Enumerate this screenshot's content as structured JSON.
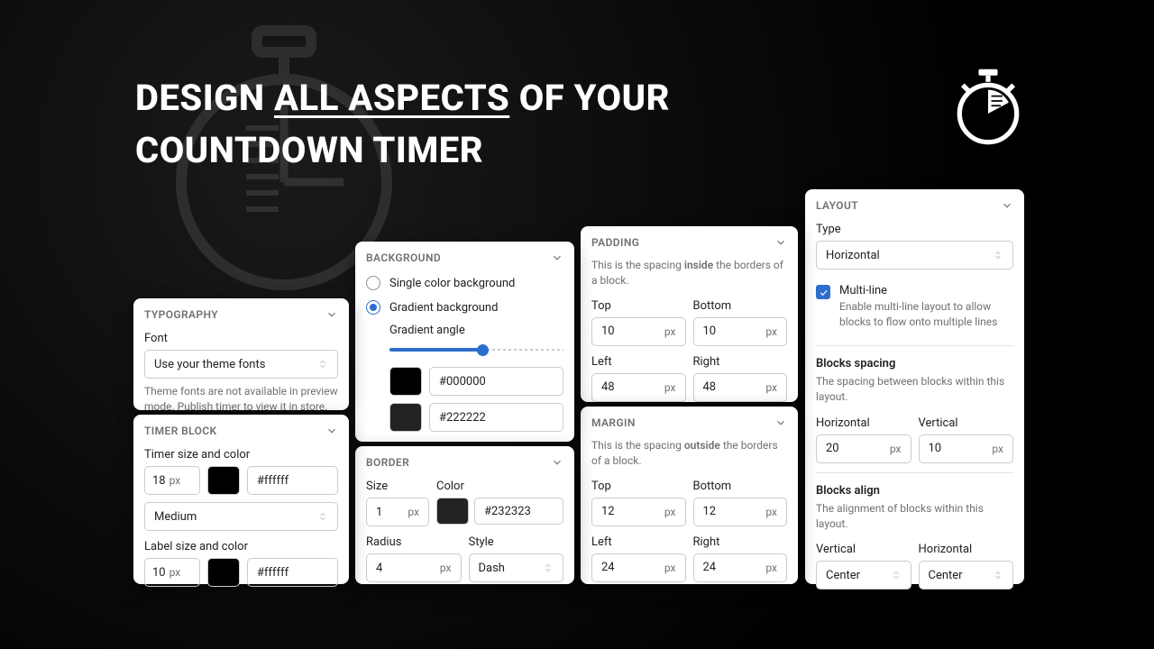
{
  "hero": {
    "line1_a": "DESIGN ",
    "line1_b": "ALL ASPECTS",
    "line1_c": " OF YOUR",
    "line2": "COUNTDOWN TIMER"
  },
  "layout": {
    "title": "LAYOUT",
    "type_label": "Type",
    "type_value": "Horizontal",
    "multiline_label": "Multi-line",
    "multiline_help": "Enable multi-line layout to allow blocks to flow onto multiple lines",
    "spacing_title": "Blocks spacing",
    "spacing_help": "The spacing between blocks within this layout.",
    "h_label": "Horizontal",
    "h_value": "20",
    "v_label": "Vertical",
    "v_value": "10",
    "unit": "px",
    "align_title": "Blocks align",
    "align_help": "The alignment of blocks within this layout.",
    "va_label": "Vertical",
    "va_value": "Center",
    "ha_label": "Horizontal",
    "ha_value": "Center"
  },
  "padding": {
    "title": "PADDING",
    "help_a": "This is the spacing ",
    "help_b": "inside",
    "help_c": " the borders of a block.",
    "top": "Top",
    "bottom": "Bottom",
    "left": "Left",
    "right": "Right",
    "unit": "px",
    "top_v": "10",
    "bottom_v": "10",
    "left_v": "48",
    "right_v": "48"
  },
  "margin": {
    "title": "MARGIN",
    "help_a": "This is the spacing ",
    "help_b": "outside",
    "help_c": " the borders of a block.",
    "top": "Top",
    "bottom": "Bottom",
    "left": "Left",
    "right": "Right",
    "unit": "px",
    "top_v": "12",
    "bottom_v": "12",
    "left_v": "24",
    "right_v": "24"
  },
  "background": {
    "title": "BACKGROUND",
    "opt1": "Single color background",
    "opt2": "Gradient background",
    "angle_label": "Gradient angle",
    "color1": "#000000",
    "color2": "#222222",
    "swatch1": "#000000",
    "swatch2": "#222222"
  },
  "border": {
    "title": "BORDER",
    "size_label": "Size",
    "size_value": "1",
    "color_label": "Color",
    "color_value": "#232323",
    "color_swatch": "#232323",
    "radius_label": "Radius",
    "radius_value": "4",
    "style_label": "Style",
    "style_value": "Dash",
    "unit": "px"
  },
  "typography": {
    "title": "TYPOGRAPHY",
    "font_label": "Font",
    "font_value": "Use your theme fonts",
    "help": "Theme fonts are not available in preview mode. Publish timer to view it in store."
  },
  "timerblock": {
    "title": "TIMER BLOCK",
    "timer_label": "Timer size and color",
    "timer_size": "18",
    "timer_swatch": "#000000",
    "timer_color": "#ffffff",
    "weight": "Medium",
    "label_label": "Label size and color",
    "label_size": "10",
    "label_swatch": "#000000",
    "label_color": "#ffffff",
    "unit": "px"
  }
}
